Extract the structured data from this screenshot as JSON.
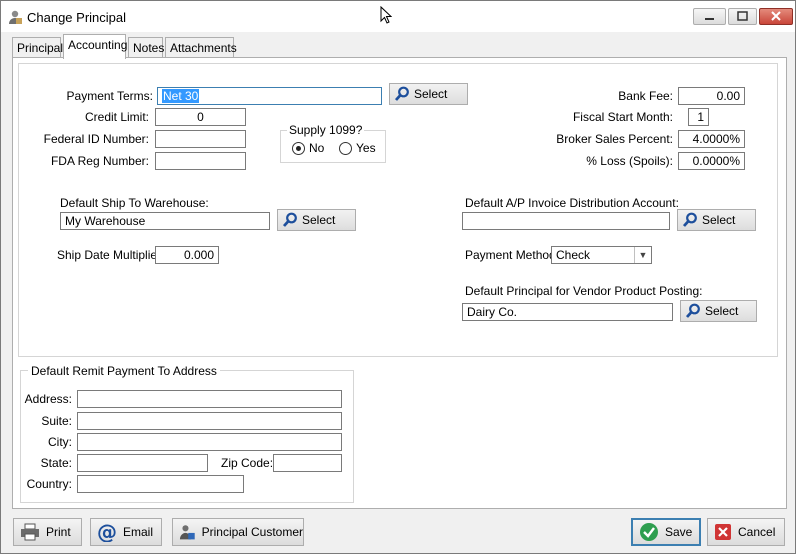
{
  "window": {
    "title": "Change Principal"
  },
  "tabs": [
    {
      "label": "Principal"
    },
    {
      "label": "Accounting"
    },
    {
      "label": "Notes"
    },
    {
      "label": "Attachments"
    }
  ],
  "form": {
    "payment_terms_label": "Payment Terms:",
    "payment_terms_value": "Net 30",
    "payment_terms_select": "Select",
    "credit_limit_label": "Credit Limit:",
    "credit_limit_value": "0",
    "federal_id_label": "Federal ID Number:",
    "federal_id_value": "",
    "fda_reg_label": "FDA Reg Number:",
    "fda_reg_value": "",
    "supply_1099_label": "Supply 1099?",
    "supply_1099_no": "No",
    "supply_1099_yes": "Yes",
    "bank_fee_label": "Bank Fee:",
    "bank_fee_value": "0.00",
    "fiscal_start_label": "Fiscal Start Month:",
    "fiscal_start_value": "1",
    "broker_sales_label": "Broker Sales Percent:",
    "broker_sales_value": "4.0000%",
    "loss_label": "% Loss (Spoils):",
    "loss_value": "0.0000%",
    "ship_warehouse_label": "Default Ship To Warehouse:",
    "ship_warehouse_value": "My Warehouse",
    "ship_warehouse_select": "Select",
    "ap_account_label": "Default A/P Invoice Distribution Account:",
    "ap_account_value": "",
    "ap_account_select": "Select",
    "ship_multiplier_label": "Ship Date Multiplier:",
    "ship_multiplier_value": "0.000",
    "payment_method_label": "Payment Method:",
    "payment_method_value": "Check",
    "vendor_principal_label": "Default Principal for Vendor Product Posting:",
    "vendor_principal_value": "Dairy Co.",
    "vendor_principal_select": "Select"
  },
  "remit": {
    "legend": "Default Remit Payment To Address",
    "address_label": "Address:",
    "suite_label": "Suite:",
    "city_label": "City:",
    "state_label": "State:",
    "zip_label": "Zip Code:",
    "country_label": "Country:"
  },
  "footer": {
    "print": "Print",
    "email": "Email",
    "principal_customer": "Principal Customer",
    "save": "Save",
    "cancel": "Cancel"
  },
  "colors": {
    "focus_border": "#3c7fb1",
    "selection": "#3399ff",
    "close_button": "#c9463a",
    "save_check": "#2e9e4f",
    "cancel_x": "#d03434"
  }
}
